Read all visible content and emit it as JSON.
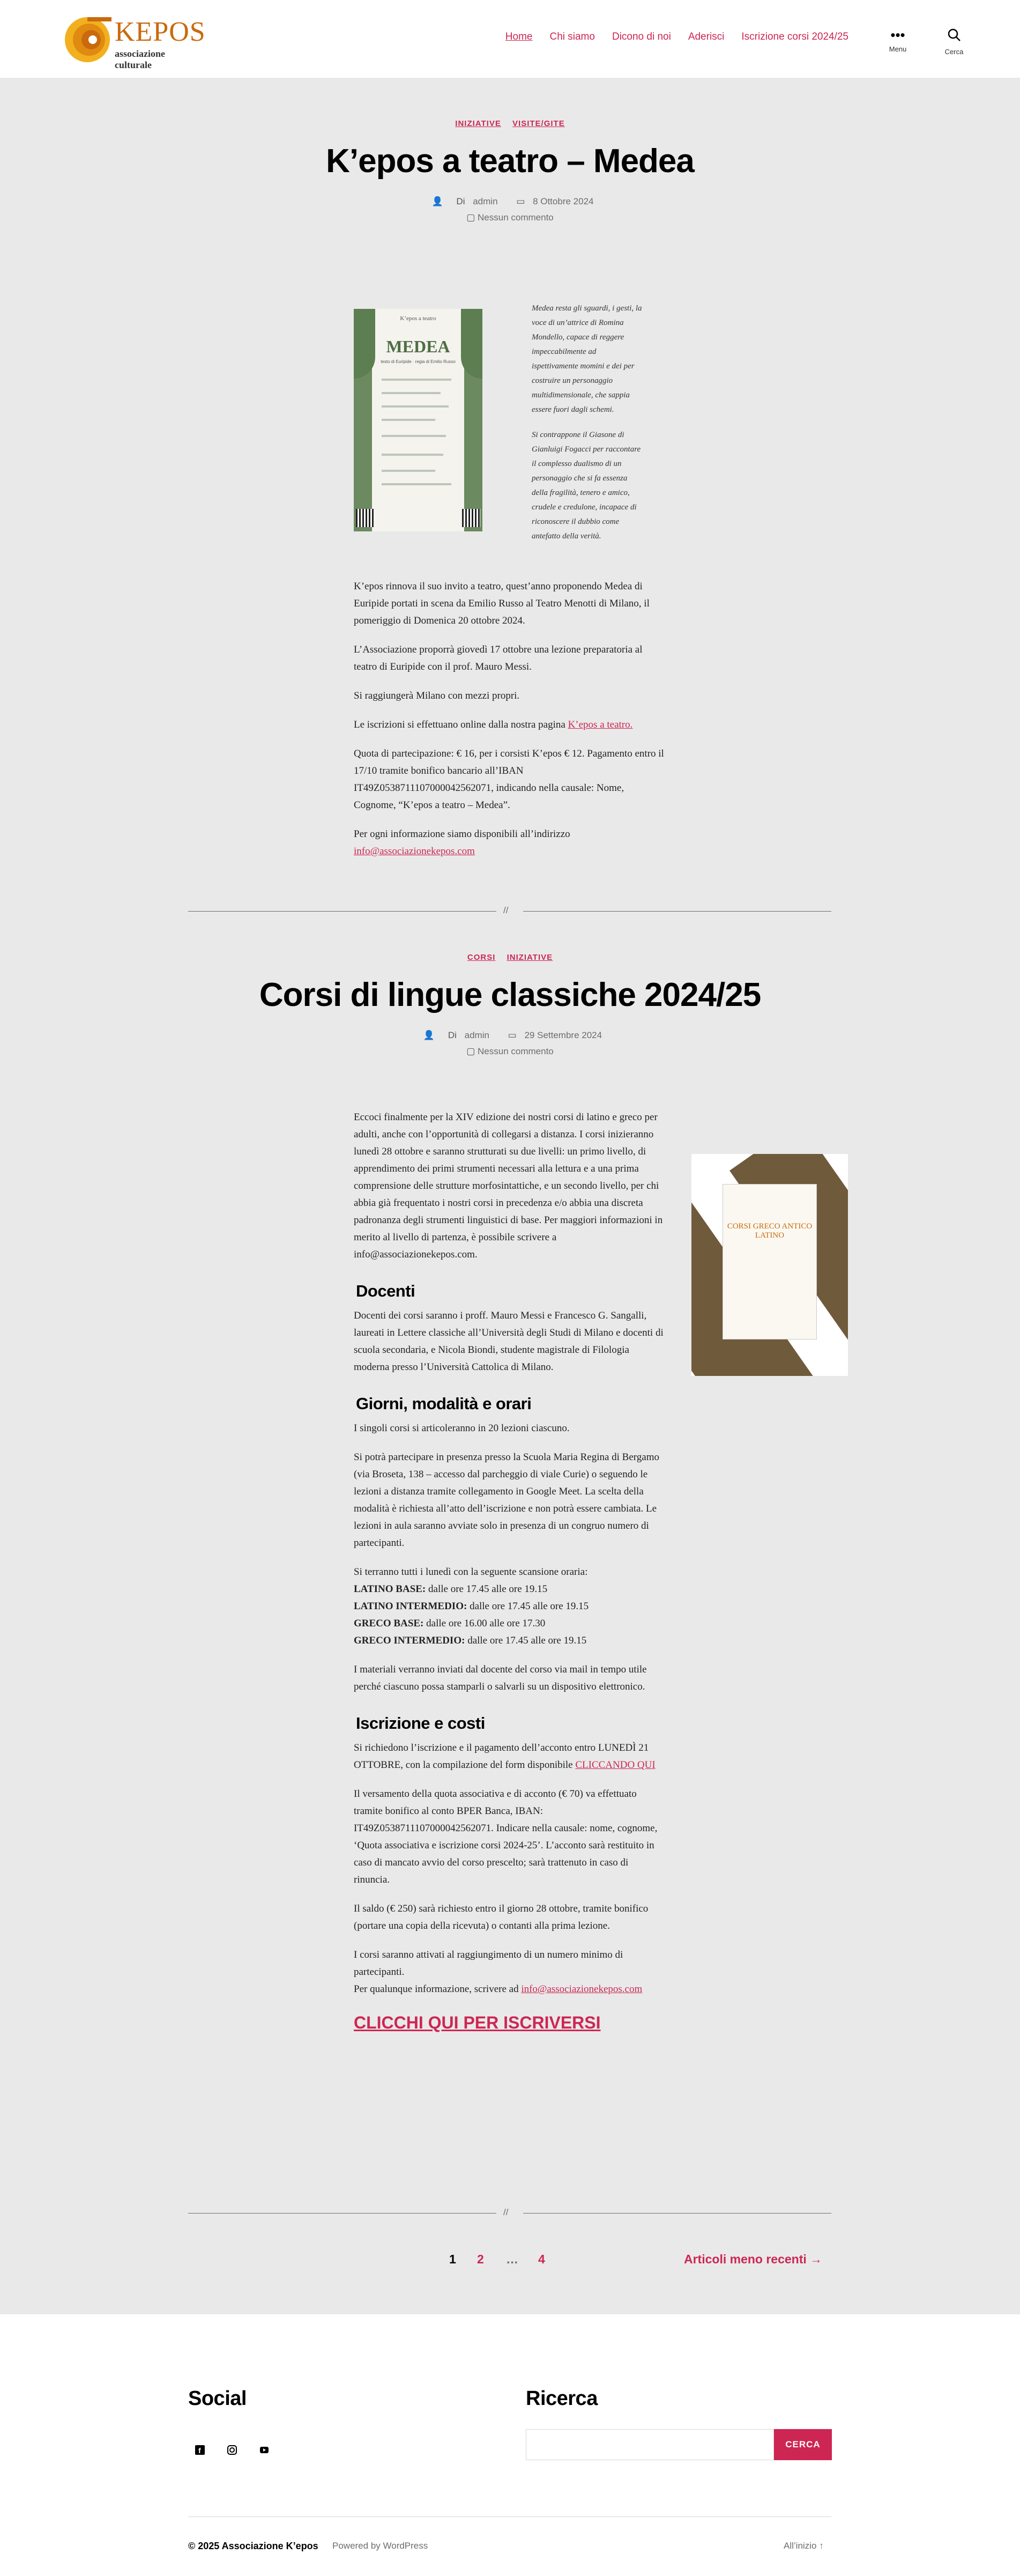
{
  "header": {
    "logo_word": "KEPOS",
    "logo_sub": "associazione culturale",
    "nav": [
      "Home",
      "Chi siamo",
      "Dicono di noi",
      "Aderisci",
      "Iscrizione corsi 2024/25"
    ],
    "menu_label": "Menu",
    "search_label": "Cerca"
  },
  "post1": {
    "categories": [
      "INIZIATIVE",
      "VISITE/GITE"
    ],
    "title": "K’epos a teatro – Medea",
    "author_prefix": "Di",
    "author": "admin",
    "date": "8 Ottobre 2024",
    "comments": "Nessun commento",
    "poster": {
      "header": "K’epos a teatro",
      "title": "MEDEA",
      "sub": "testo di Euripide · regia di Emilio Russo"
    },
    "quote": [
      "Medea resta gli sguardi, i gesti, la voce di un’attrice di Romina Mondello, capace di reggere impeccabilmente ad ispettivamente momini e dei per costruire un personaggio multidimensionale, che sappia essere fuori dagli schemi.",
      "Si contrappone il Giasone di Gianluigi Fogacci per raccontare il complesso dualismo di un personaggio che si fa essenza della fragilità, tenero e amico, crudele e credulone, incapace di riconoscere il dubbio come antefatto della verità."
    ],
    "paragraphs": [
      "K’epos rinnova il suo invito a teatro, quest’anno proponendo Medea di Euripide portati in scena da Emilio Russo al Teatro Menotti di Milano, il pomeriggio di Domenica 20 ottobre 2024.",
      "L’Associazione proporrà giovedì 17 ottobre una lezione preparatoria al teatro di Euripide con il prof. Mauro Messi.",
      "Si raggiungerà Milano con mezzi propri.",
      "Le iscrizioni si effettuano online dalla nostra pagina",
      "Quota di partecipazione: € 16, per i corsisti K’epos € 12. Pagamento entro il 17/10 tramite bonifico bancario all’IBAN IT49Z0538711107000042562071, indicando nella causale: Nome, Cognome, “K’epos a teatro – Medea”.",
      "Per ogni informazione siamo disponibili all’indirizzo"
    ],
    "link_teatro": "K’epos a teatro.",
    "email": "info@associazionekepos.com"
  },
  "separator": "//",
  "post2": {
    "categories": [
      "CORSI",
      "INIZIATIVE"
    ],
    "title": "Corsi di lingue classiche 2024/25",
    "author_prefix": "Di",
    "author": "admin",
    "date": "29 Settembre 2024",
    "comments": "Nessun commento",
    "poster_title": "CORSI GRECO ANTICO LATINO",
    "intro": "Eccoci finalmente per la XIV edizione dei nostri corsi di latino e greco per adulti, anche con l’opportunità di collegarsi a distanza. I corsi inizieranno lunedì 28 ottobre e saranno strutturati su due livelli: un primo livello, di apprendimento dei primi strumenti necessari alla lettura e a una prima comprensione delle strutture morfosintattiche, e un secondo livello, per chi abbia già frequentato i nostri corsi in precedenza e/o abbia una discreta padronanza degli strumenti linguistici di base. Per maggiori informazioni in merito al livello di partenza, è possibile scrivere a info@associazionekepos.com.",
    "h_docenti": "Docenti",
    "docenti": "Docenti dei corsi saranno i proff. Mauro Messi e Francesco G. Sangalli, laureati in Lettere classiche all’Università degli Studi di Milano e docenti di scuola secondaria, e Nicola Biondi, studente magistrale di Filologia moderna presso l’Università Cattolica di Milano.",
    "h_giorni": "Giorni, modalità e orari",
    "giorni1": "I singoli corsi si articoleranno in 20 lezioni ciascuno.",
    "giorni2": "Si potrà partecipare in presenza presso la Scuola Maria Regina di Bergamo (via Broseta, 138 – accesso dal parcheggio di viale Curie) o seguendo le lezioni a distanza tramite collegamento in Google Meet. La scelta della modalità è richiesta all’atto dell’iscrizione e non potrà essere cambiata. Le lezioni in aula saranno avviate solo in presenza di un congruo numero di partecipanti.",
    "giorni3_intro": "Si terranno tutti i lunedì con la seguente scansione oraria:",
    "orari": [
      {
        "label": "LATINO BASE:",
        "time": " dalle ore 17.45 alle ore 19.15"
      },
      {
        "label": "LATINO INTERMEDIO:",
        "time": " dalle ore 17.45 alle ore 19.15"
      },
      {
        "label": "GRECO BASE:",
        "time": " dalle ore 16.00 alle ore 17.30"
      },
      {
        "label": "GRECO INTERMEDIO:",
        "time": " dalle ore 17.45 alle ore 19.15"
      }
    ],
    "giorni4": "I materiali verranno inviati dal docente del corso via mail in tempo utile perché ciascuno possa stamparli o salvarli su un dispositivo elettronico.",
    "h_iscrizione": "Iscrizione e costi",
    "iscr1": "Si richiedono l’iscrizione e il pagamento dell’acconto entro LUNEDÌ 21 OTTOBRE, con la compilazione del form disponibile",
    "iscr1_link": "CLICCANDO QUI",
    "iscr2": "Il versamento della quota associativa e di acconto (€ 70) va effettuato tramite bonifico al conto BPER Banca, IBAN: IT49Z0538711107000042562071. Indicare nella causale: nome, cognome, ‘Quota associativa e iscrizione corsi 2024-25’. L’acconto sarà restituito in caso di mancato avvio del corso prescelto; sarà trattenuto in caso di rinuncia.",
    "iscr3": "Il saldo (€ 250) sarà richiesto entro il giorno 28 ottobre, tramite bonifico (portare una copia della ricevuta) o contanti alla prima lezione.",
    "iscr4": "I corsi saranno attivati al raggiungimento di un numero minimo di partecipanti.",
    "iscr5": "Per qualunque informazione, scrivere ad",
    "email": "info@associazionekepos.com",
    "cta": "CLICCHI QUI PER ISCRIVERSI"
  },
  "pagination": {
    "pages": [
      "1",
      "2",
      "…",
      "4"
    ],
    "next": "Articoli meno recenti →"
  },
  "footer": {
    "social_title": "Social",
    "social_icons": [
      "facebook-icon",
      "instagram-icon",
      "youtube-icon"
    ],
    "search_title": "Ricerca",
    "search_button": "CERCA",
    "copyright": "© 2025 Associazione K’epos",
    "powered": "Powered by WordPress",
    "to_top": "All’inizio ↑"
  },
  "colors": {
    "accent": "#cd2653",
    "background": "#e9e9e9",
    "poster_green": "#6b8a5f"
  }
}
